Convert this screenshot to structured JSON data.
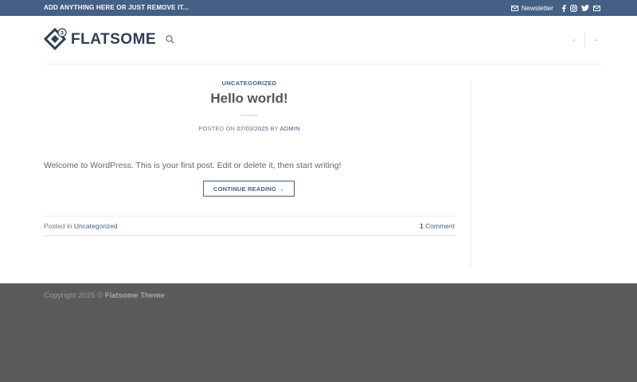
{
  "topbar": {
    "message": "ADD ANYTHING HERE OR JUST REMOVE IT...",
    "newsletter_label": "Newsletter",
    "social_icons": [
      "facebook-icon",
      "instagram-icon",
      "twitter-icon",
      "envelope-icon"
    ]
  },
  "header": {
    "logo_text": "FLATSOME",
    "logo_badge": "3",
    "right_items": [
      "-",
      "-"
    ]
  },
  "post": {
    "category": "UNCATEGORIZED",
    "title": "Hello world!",
    "meta_prefix": "POSTED ON",
    "date": "07/03/2025",
    "meta_by": "BY",
    "author": "ADMIN",
    "excerpt": "Welcome to WordPress. This is your first post. Edit or delete it, then start writing!",
    "continue_label": "CONTINUE READING →",
    "posted_in_label": "Posted in",
    "posted_in_category": "Uncategorized",
    "comment_count": "1",
    "comment_label": "Comment"
  },
  "footer": {
    "copyright_prefix": "Copyright 2025 ©",
    "theme_name": "Flatsome Theme"
  },
  "colors": {
    "primary": "#446084",
    "footer_bg": "#5b5b5b"
  }
}
